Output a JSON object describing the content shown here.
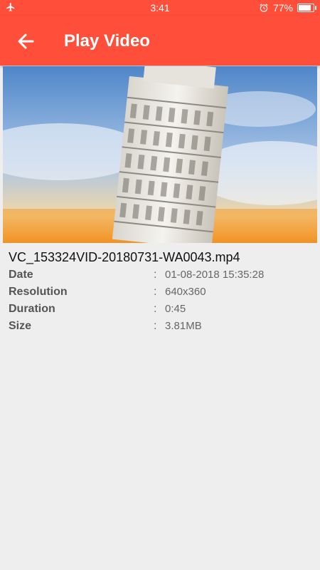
{
  "status_bar": {
    "time": "3:41",
    "battery_percent_text": "77%",
    "battery_level": 0.77,
    "icons": [
      "airplane-icon",
      "alarm-icon",
      "battery-icon"
    ]
  },
  "app_bar": {
    "title": "Play Video",
    "color": "#ff4f3b"
  },
  "video": {
    "filename": "VC_153324VID-20180731-WA0043.mp4",
    "details": [
      {
        "label": "Date",
        "value": "01-08-2018 15:35:28"
      },
      {
        "label": "Resolution",
        "value": "640x360"
      },
      {
        "label": "Duration",
        "value": "0:45"
      },
      {
        "label": "Size",
        "value": "3.81MB"
      }
    ]
  }
}
